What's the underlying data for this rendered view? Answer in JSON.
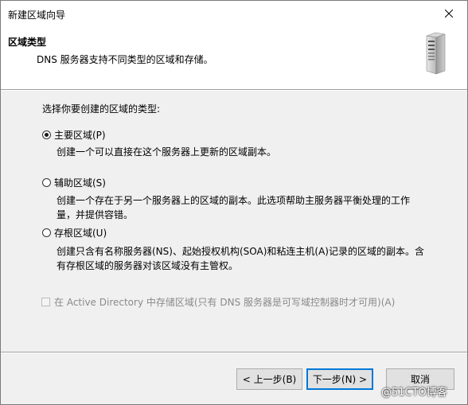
{
  "window": {
    "title": "新建区域向导"
  },
  "header": {
    "title": "区域类型",
    "subtitle": "DNS 服务器支持不同类型的区域和存储。"
  },
  "main": {
    "prompt": "选择你要创建的区域的类型:",
    "options": [
      {
        "label": "主要区域(P)",
        "selected": true,
        "description": [
          "创建一个可以直接在这个服务器上更新的区域副本。"
        ]
      },
      {
        "label": "辅助区域(S)",
        "selected": false,
        "description": [
          "创建一个存在于另一个服务器上的区域的副本。此选项帮助主服务器平衡处理的工作",
          "量，并提供容错。"
        ]
      },
      {
        "label": "存根区域(U)",
        "selected": false,
        "description": [
          "创建只含有名称服务器(NS)、起始授权机构(SOA)和粘连主机(A)记录的区域的副本。含",
          "有存根区域的服务器对该区域没有主管权。"
        ]
      }
    ],
    "ad_checkbox": {
      "label": "在 Active Directory 中存储区域(只有 DNS 服务器是可写域控制器时才可用)(A)",
      "checked": false,
      "enabled": false
    }
  },
  "footer": {
    "back_label": "< 上一步(B)",
    "next_label": "下一步(N) >",
    "cancel_label": "取消"
  },
  "watermark": "@51CTO博客",
  "icons": {
    "close": "close-icon",
    "server": "server-icon"
  }
}
